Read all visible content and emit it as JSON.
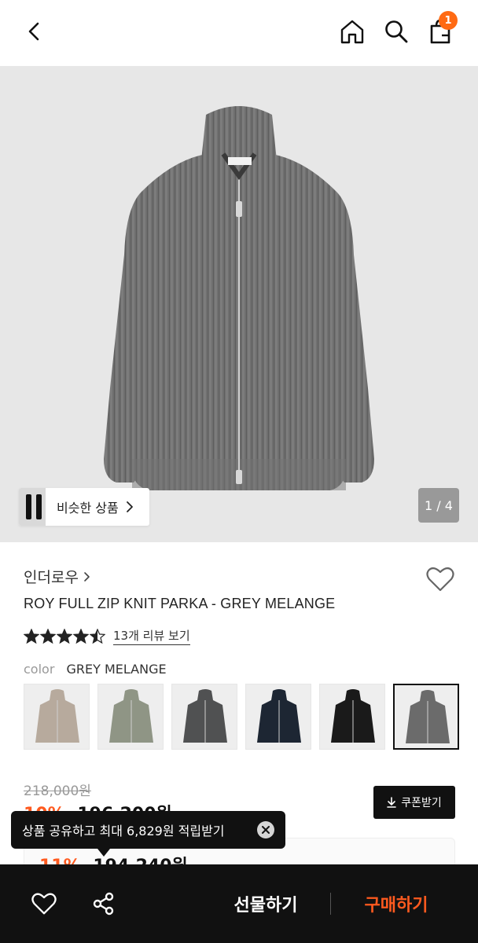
{
  "header": {
    "cart_count": "1"
  },
  "gallery": {
    "similar_label": "비슷한 상품",
    "pager": "1 / 4"
  },
  "product": {
    "brand": "인더로우",
    "title": "ROY FULL ZIP KNIT PARKA - GREY MELANGE",
    "rating": 4.5,
    "review_link": "13개 리뷰 보기",
    "color_label": "color",
    "color_value": "GREY MELANGE",
    "swatch_colors": [
      "#b7aa9d",
      "#8f9585",
      "#505152",
      "#1d2633",
      "#1a1a1a",
      "#6b6b6b"
    ],
    "selected_swatch": 5
  },
  "price": {
    "original": "218,000원",
    "discount_pct": "10%",
    "discounted": "196,200원",
    "coupon_label": "쿠폰받기",
    "best_pct": "11%",
    "best_price": "194,240원"
  },
  "tooltip": {
    "text": "상품 공유하고 최대 6,829원 적립받기"
  },
  "bottom_bar": {
    "gift_label": "선물하기",
    "buy_label": "구매하기"
  },
  "colors": {
    "accent": "#ff5a1f",
    "badge": "#ff6a13",
    "bar": "#111111"
  }
}
